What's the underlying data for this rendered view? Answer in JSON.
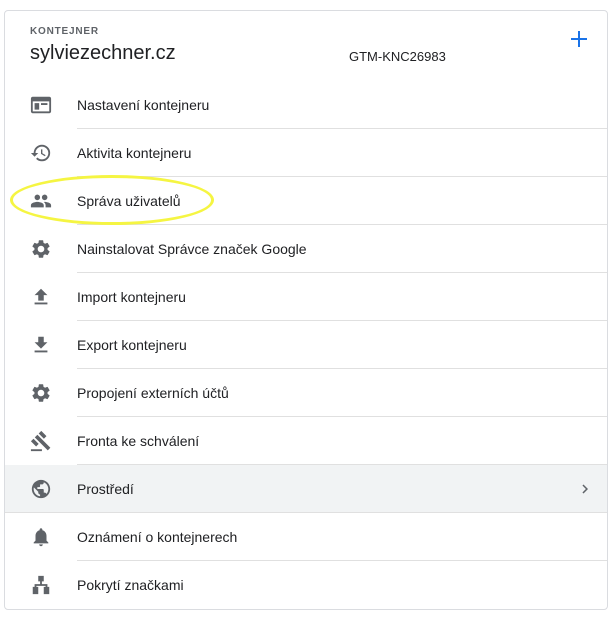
{
  "header": {
    "section_label": "KONTEJNER",
    "container_name": "sylviezechner.cz",
    "container_id": "GTM-KNC26983",
    "add_icon": "plus-icon"
  },
  "menu": {
    "items": [
      {
        "label": "Nastavení kontejneru",
        "icon": "settings-window-icon"
      },
      {
        "label": "Aktivita kontejneru",
        "icon": "history-icon"
      },
      {
        "label": "Správa uživatelů",
        "icon": "people-icon"
      },
      {
        "label": "Nainstalovat Správce značek Google",
        "icon": "gear-icon"
      },
      {
        "label": "Import kontejneru",
        "icon": "upload-icon"
      },
      {
        "label": "Export kontejneru",
        "icon": "download-icon"
      },
      {
        "label": "Propojení externích účtů",
        "icon": "gear-icon"
      },
      {
        "label": "Fronta ke schválení",
        "icon": "gavel-icon"
      },
      {
        "label": "Prostředí",
        "icon": "globe-icon"
      },
      {
        "label": "Oznámení o kontejnerech",
        "icon": "bell-icon"
      },
      {
        "label": "Pokrytí značkami",
        "icon": "hierarchy-icon"
      }
    ],
    "active_item": "Prostředí"
  },
  "colors": {
    "accent": "#1a73e8",
    "icon": "#5f6368",
    "highlight": "#f5f542",
    "active_background": "#f1f3f4"
  }
}
